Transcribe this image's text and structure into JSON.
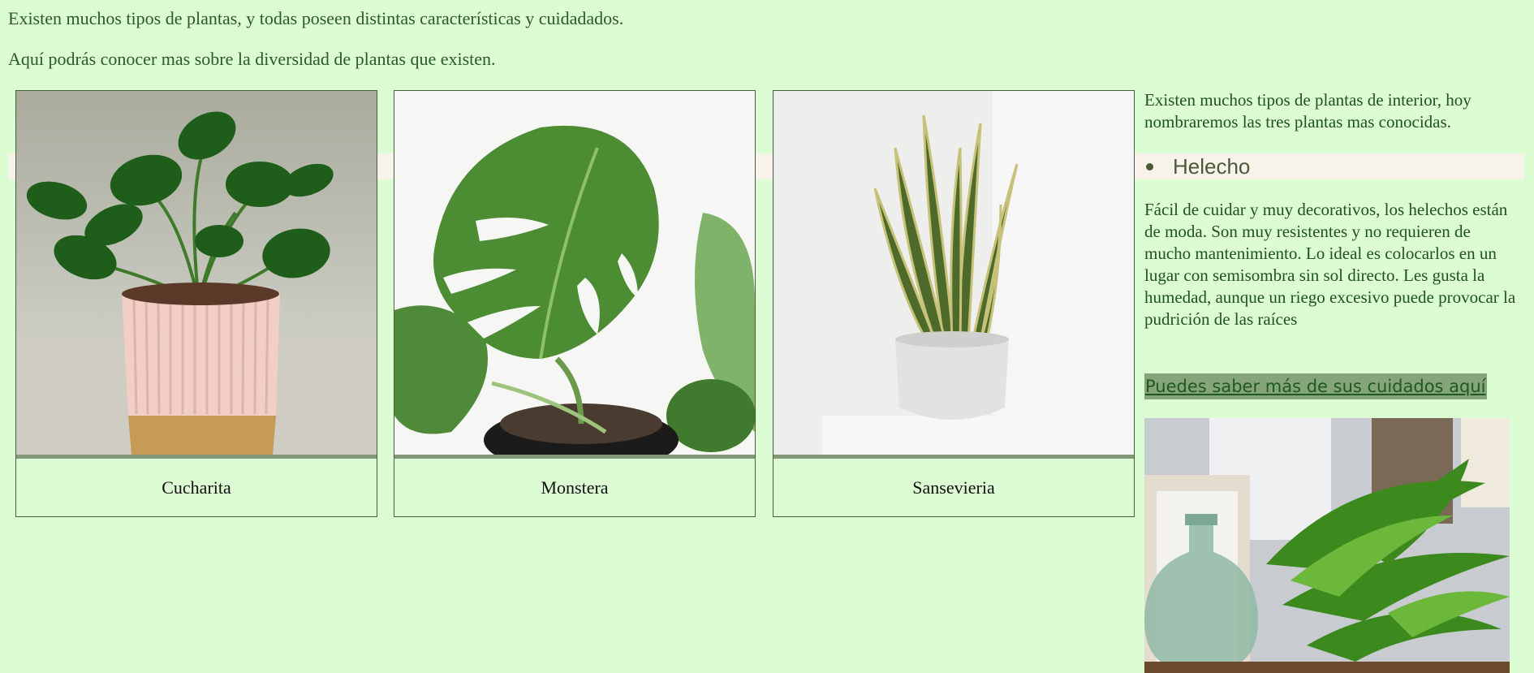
{
  "intro": {
    "line1": "Existen muchos tipos de plantas, y todas poseen distintas características y cuidadados.",
    "line2": "Aquí podrás conocer mas sobre la diversidad de plantas que existen."
  },
  "cards": [
    {
      "caption": "Cucharita",
      "image": "pilea-plant-pink-pot"
    },
    {
      "caption": "Monstera",
      "image": "monstera-leaf"
    },
    {
      "caption": "Sansevieria",
      "image": "snake-plant-white-pot"
    }
  ],
  "aside": {
    "intro": "Existen muchos tipos de plantas de interior, hoy nombraremos las tres plantas mas conocidas.",
    "fern": {
      "title": "Helecho",
      "description": "Fácil de cuidar y muy decorativos, los helechos están de moda. Son muy resistentes y no requieren de mucho mantenimiento. Lo ideal es colocarlos en un lugar con semisombra sin sol directo. Les gusta la humedad, aunque un riego excesivo puede provocar la pudrición de las raíces",
      "link_text": "Puedes saber más de sus cuidados aquí",
      "image": "fern-with-glass-jar"
    }
  },
  "colors": {
    "background": "#dcfcd4",
    "text": "#1f5220",
    "band": "#f7f3ea",
    "link_bg": "#86a47a",
    "card_divider": "#849878"
  }
}
